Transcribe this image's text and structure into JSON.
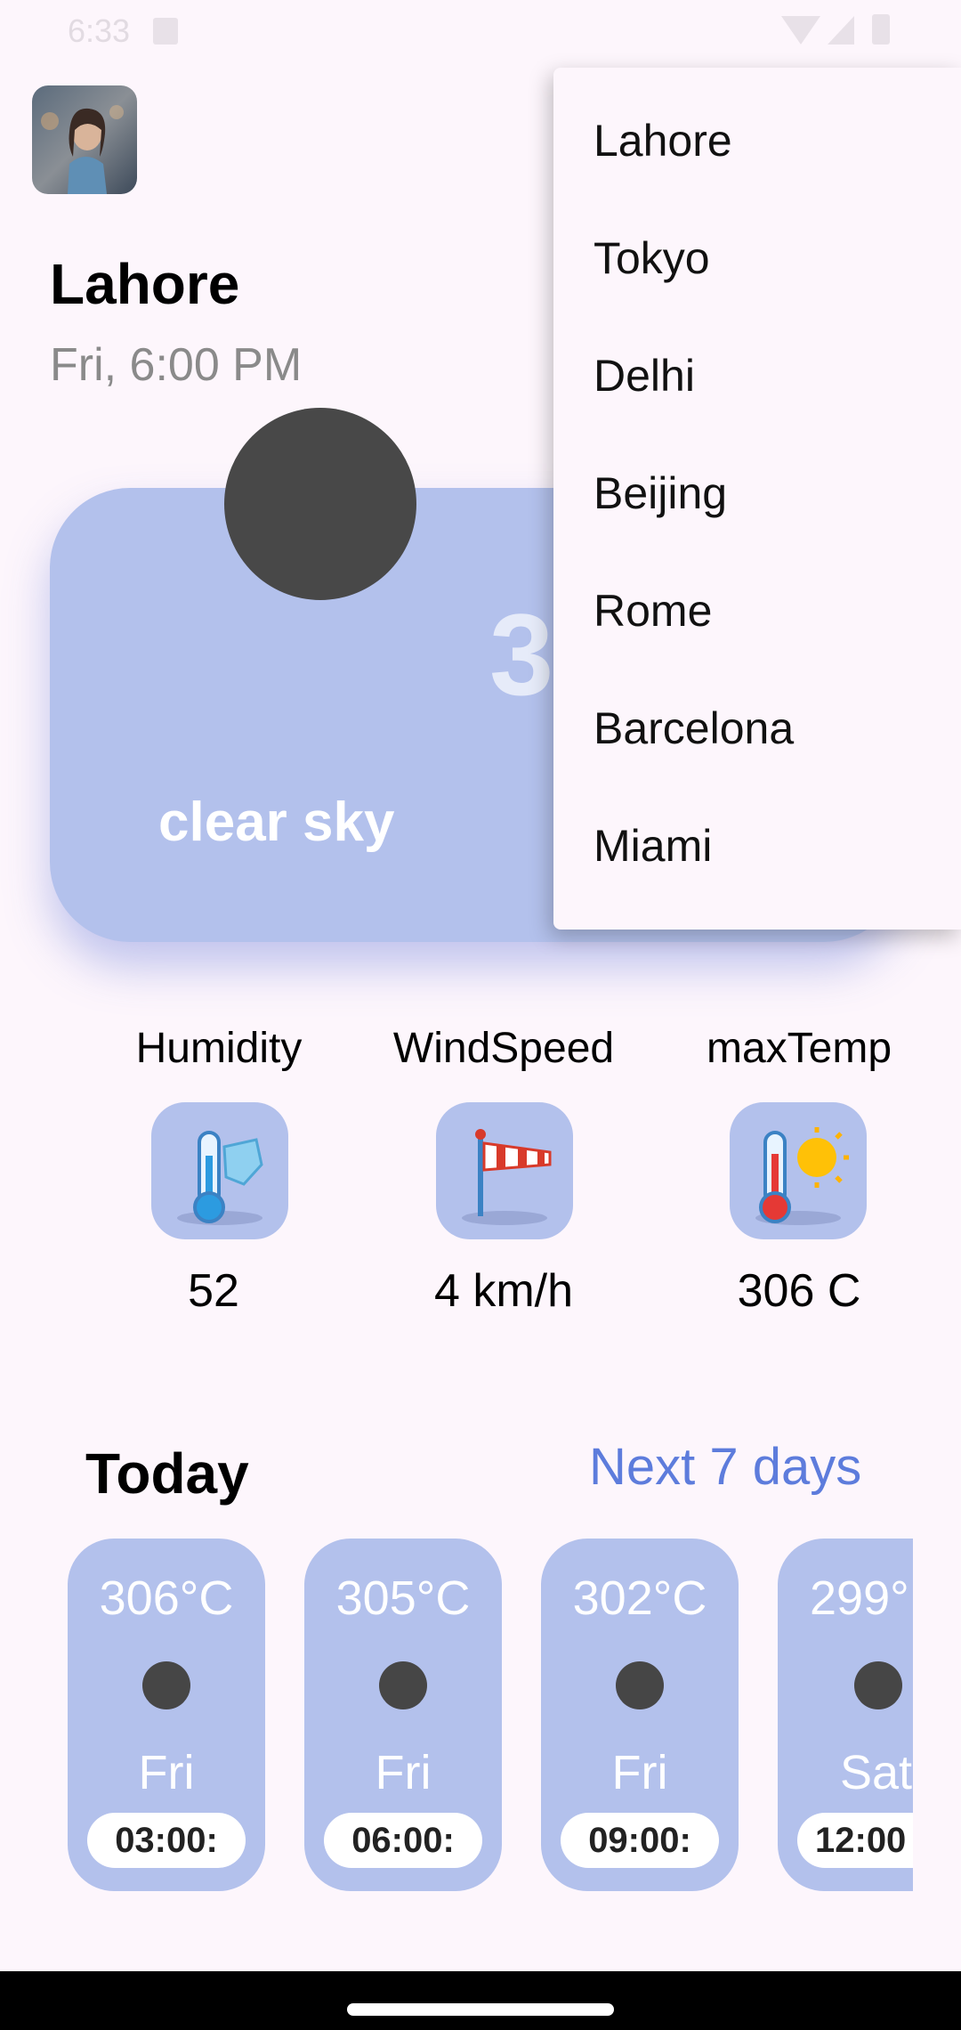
{
  "status_bar": {
    "time": "6:33"
  },
  "header": {
    "city": "Lahore",
    "datetime": "Fri, 6:00 PM"
  },
  "weather_card": {
    "temperature": "3",
    "condition": "clear sky"
  },
  "stats": [
    {
      "label": "Humidity",
      "value": "52",
      "icon": "humidity-thermometer-icon"
    },
    {
      "label": "WindSpeed",
      "value": "4 km/h",
      "icon": "windsock-icon"
    },
    {
      "label": "maxTemp",
      "value": "306 C",
      "icon": "hot-thermometer-icon"
    }
  ],
  "today": {
    "title": "Today",
    "next_link": "Next 7 days",
    "forecast": [
      {
        "temp": "306°C",
        "day": "Fri",
        "time": "03:00:"
      },
      {
        "temp": "305°C",
        "day": "Fri",
        "time": "06:00:"
      },
      {
        "temp": "302°C",
        "day": "Fri",
        "time": "09:00:"
      },
      {
        "temp": "299°",
        "day": "Sat",
        "time": "12:00"
      }
    ]
  },
  "dropdown": {
    "items": [
      "Lahore",
      "Tokyo",
      "Delhi",
      "Beijing",
      "Rome",
      "Barcelona",
      "Miami"
    ]
  },
  "colors": {
    "card": "#b3c1ec",
    "link": "#5d7cdc",
    "background": "#fdf6fc"
  }
}
